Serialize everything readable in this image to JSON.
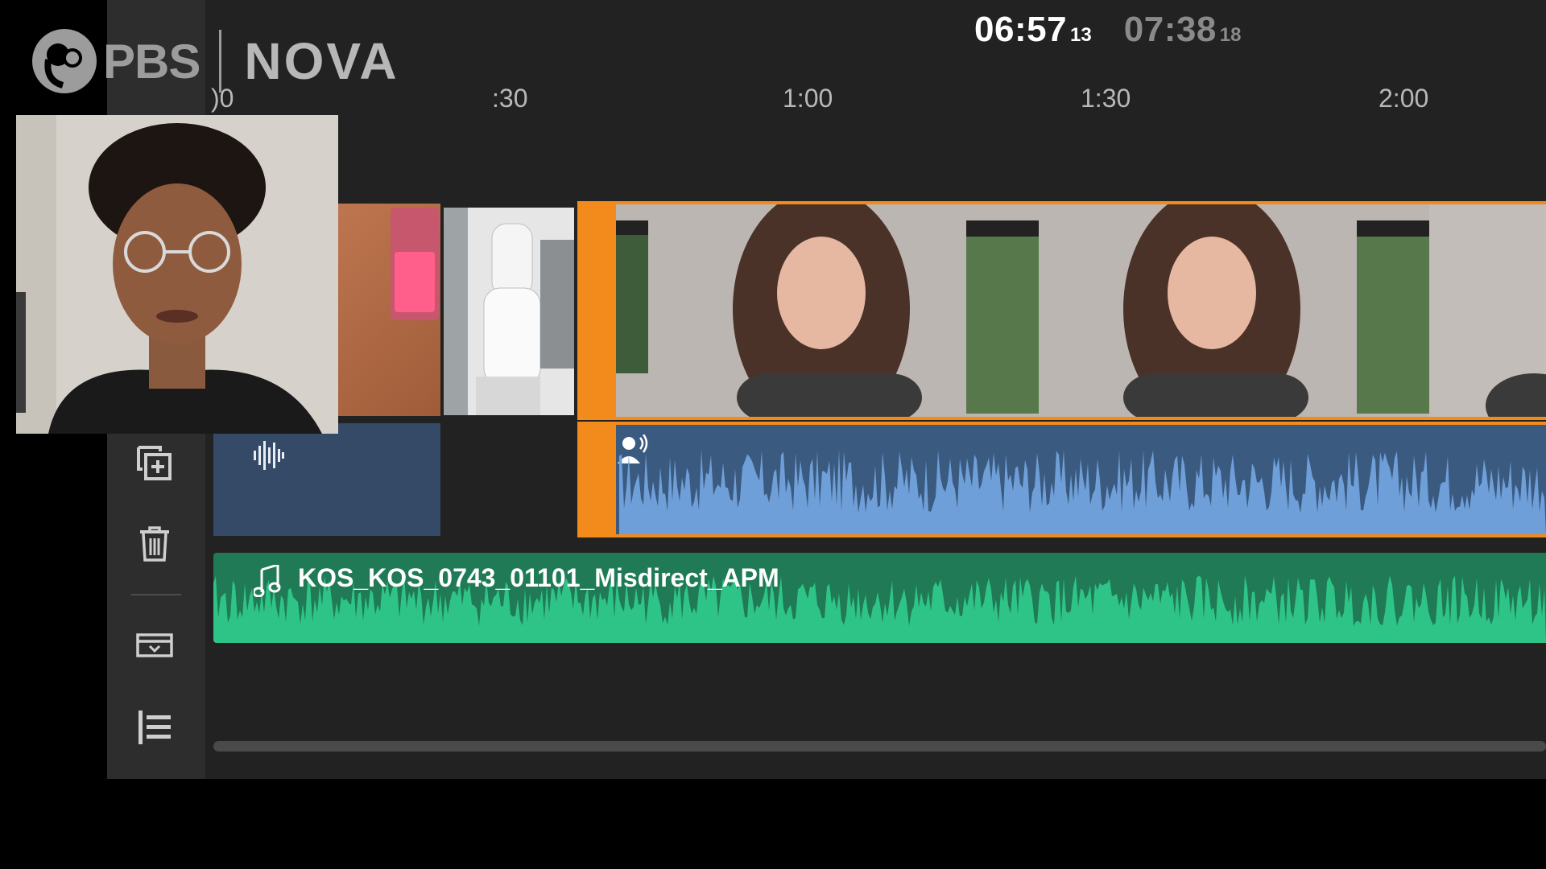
{
  "overlay": {
    "brand_pbs": "PBS",
    "brand_nova": "NOVA"
  },
  "timecode": {
    "current": "06:57",
    "current_frames": "13",
    "total": "07:38",
    "total_frames": "18"
  },
  "ruler": {
    "labels": [
      ")0",
      ":30",
      "1:00",
      "1:30",
      "2:00"
    ]
  },
  "tracks": {
    "music_clip_name": "KOS_KOS_0743_01101_Misdirect_APM"
  },
  "tools": {
    "icons": [
      "duplicate-clip-icon",
      "trash-icon",
      "collapse-tracks-icon",
      "track-list-icon"
    ]
  },
  "colors": {
    "accent_orange": "#f28a1c",
    "audio_blue": "#6f9fd8",
    "audio_blue_bg": "#3a5a80",
    "voice_empty_bg": "#344a66",
    "music_green": "#2fc487",
    "music_green_bg": "#1f7a55"
  }
}
